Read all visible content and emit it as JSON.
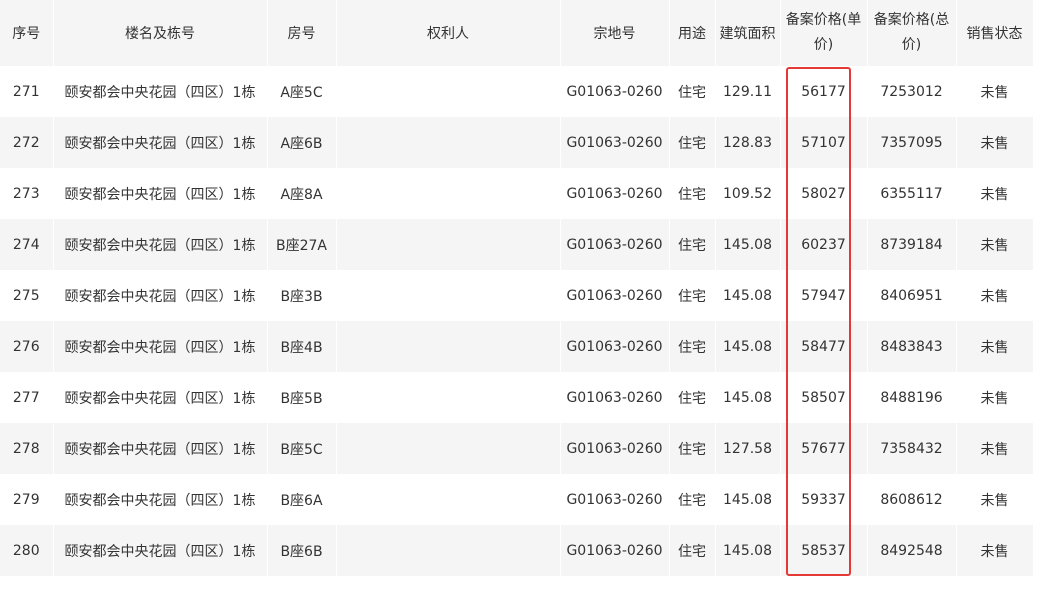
{
  "headers": {
    "seq": "序号",
    "building": "楼名及栋号",
    "room": "房号",
    "owner": "权利人",
    "land_no": "宗地号",
    "usage": "用途",
    "area": "建筑面积",
    "unit_price_line1": "备案价格(单",
    "unit_price_line2": "价)",
    "total_price_line1": "备案价格(总",
    "total_price_line2": "价)",
    "status": "销售状态"
  },
  "rows": [
    {
      "seq": "271",
      "building": "颐安都会中央花园（四区）1栋",
      "room": "A座5C",
      "owner": "",
      "land_no": "G01063-0260",
      "usage": "住宅",
      "area": "129.11",
      "unit_price": "56177",
      "total_price": "7253012",
      "status": "未售"
    },
    {
      "seq": "272",
      "building": "颐安都会中央花园（四区）1栋",
      "room": "A座6B",
      "owner": "",
      "land_no": "G01063-0260",
      "usage": "住宅",
      "area": "128.83",
      "unit_price": "57107",
      "total_price": "7357095",
      "status": "未售"
    },
    {
      "seq": "273",
      "building": "颐安都会中央花园（四区）1栋",
      "room": "A座8A",
      "owner": "",
      "land_no": "G01063-0260",
      "usage": "住宅",
      "area": "109.52",
      "unit_price": "58027",
      "total_price": "6355117",
      "status": "未售"
    },
    {
      "seq": "274",
      "building": "颐安都会中央花园（四区）1栋",
      "room": "B座27A",
      "owner": "",
      "land_no": "G01063-0260",
      "usage": "住宅",
      "area": "145.08",
      "unit_price": "60237",
      "total_price": "8739184",
      "status": "未售"
    },
    {
      "seq": "275",
      "building": "颐安都会中央花园（四区）1栋",
      "room": "B座3B",
      "owner": "",
      "land_no": "G01063-0260",
      "usage": "住宅",
      "area": "145.08",
      "unit_price": "57947",
      "total_price": "8406951",
      "status": "未售"
    },
    {
      "seq": "276",
      "building": "颐安都会中央花园（四区）1栋",
      "room": "B座4B",
      "owner": "",
      "land_no": "G01063-0260",
      "usage": "住宅",
      "area": "145.08",
      "unit_price": "58477",
      "total_price": "8483843",
      "status": "未售"
    },
    {
      "seq": "277",
      "building": "颐安都会中央花园（四区）1栋",
      "room": "B座5B",
      "owner": "",
      "land_no": "G01063-0260",
      "usage": "住宅",
      "area": "145.08",
      "unit_price": "58507",
      "total_price": "8488196",
      "status": "未售"
    },
    {
      "seq": "278",
      "building": "颐安都会中央花园（四区）1栋",
      "room": "B座5C",
      "owner": "",
      "land_no": "G01063-0260",
      "usage": "住宅",
      "area": "127.58",
      "unit_price": "57677",
      "total_price": "7358432",
      "status": "未售"
    },
    {
      "seq": "279",
      "building": "颐安都会中央花园（四区）1栋",
      "room": "B座6A",
      "owner": "",
      "land_no": "G01063-0260",
      "usage": "住宅",
      "area": "145.08",
      "unit_price": "59337",
      "total_price": "8608612",
      "status": "未售"
    },
    {
      "seq": "280",
      "building": "颐安都会中央花园（四区）1栋",
      "room": "B座6B",
      "owner": "",
      "land_no": "G01063-0260",
      "usage": "住宅",
      "area": "145.08",
      "unit_price": "58537",
      "total_price": "8492548",
      "status": "未售"
    }
  ],
  "colors": {
    "header_bg": "#f5f5f5",
    "stripe_bg": "#f5f5f5",
    "text": "#333333",
    "highlight": "#e53935"
  }
}
